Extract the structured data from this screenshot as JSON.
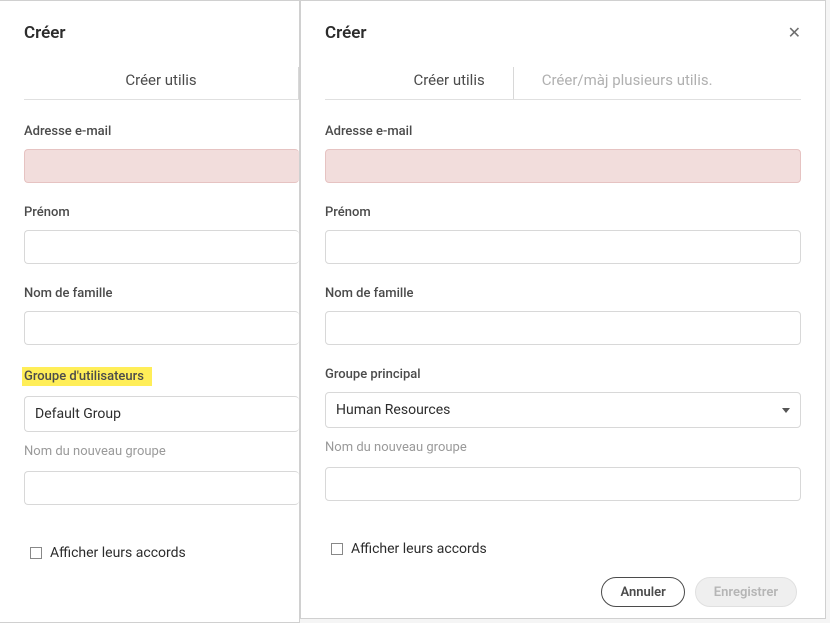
{
  "left": {
    "title": "Créer",
    "tab_label": "Créer utilis",
    "email_label": "Adresse e-mail",
    "firstname_label": "Prénom",
    "lastname_label": "Nom de famille",
    "group_label": "Groupe d'utilisateurs",
    "group_value": "Default Group",
    "new_group_placeholder": "Nom du nouveau groupe",
    "view_agreements_label": "Afficher leurs accords"
  },
  "right": {
    "title": "Créer",
    "tab1_label": "Créer utilis",
    "tab2_label": "Créer/màj plusieurs utilis.",
    "email_label": "Adresse e-mail",
    "firstname_label": "Prénom",
    "lastname_label": "Nom de famille",
    "group_label": "Groupe principal",
    "group_value": "Human Resources",
    "new_group_placeholder": "Nom du nouveau groupe",
    "view_agreements_label": "Afficher leurs accords",
    "cancel_label": "Annuler",
    "save_label": "Enregistrer"
  }
}
